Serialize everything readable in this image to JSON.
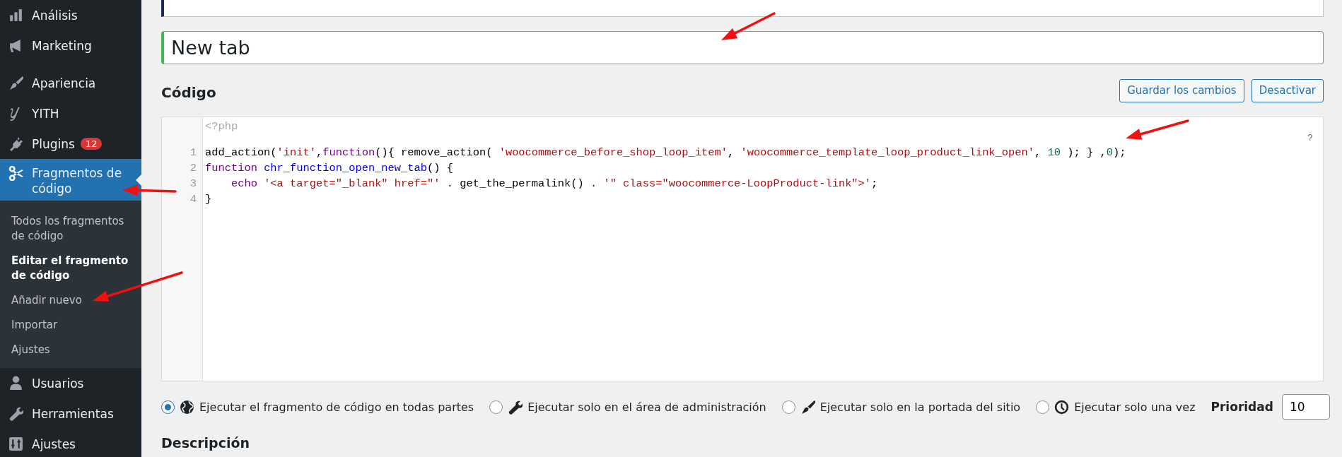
{
  "sidebar": {
    "menu_groups": [
      [
        {
          "label": "Análisis",
          "selected": false
        },
        {
          "label": "Marketing",
          "selected": false
        }
      ],
      [
        {
          "label": "Apariencia",
          "selected": false
        },
        {
          "label": "YITH",
          "selected": false
        },
        {
          "label": "Plugins",
          "selected": false,
          "badge": "12"
        },
        {
          "label": "Fragmentos de código",
          "selected": true,
          "submenu": [
            {
              "label": "Todos los fragmentos de código",
              "selected": false
            },
            {
              "label": "Editar el fragmento de código",
              "selected": true
            },
            {
              "label": "Añadir nuevo",
              "selected": false
            },
            {
              "label": "Importar",
              "selected": false
            },
            {
              "label": "Ajustes",
              "selected": false
            }
          ]
        },
        {
          "label": "Usuarios",
          "selected": false
        },
        {
          "label": "Herramientas",
          "selected": false
        },
        {
          "label": "Ajustes",
          "selected": false
        }
      ]
    ]
  },
  "title_field": {
    "value": "New tab"
  },
  "code_section": {
    "heading": "Código",
    "buttons": [
      "Guardar los cambios",
      "Desactivar"
    ]
  },
  "code_editor": {
    "header": "<?php",
    "help": "?",
    "lines": [
      {
        "number": "1",
        "tokens": [
          {
            "kind": "plain",
            "text": "add_action("
          },
          {
            "kind": "string",
            "text": "'init'"
          },
          {
            "kind": "plain",
            "text": ","
          },
          {
            "kind": "keyword",
            "text": "function"
          },
          {
            "kind": "plain",
            "text": "(){ remove_action( "
          },
          {
            "kind": "string",
            "text": "'woocommerce_before_shop_loop_item'"
          },
          {
            "kind": "plain",
            "text": ", "
          },
          {
            "kind": "string",
            "text": "'woocommerce_template_loop_product_link_open'"
          },
          {
            "kind": "plain",
            "text": ", "
          },
          {
            "kind": "number",
            "text": "10"
          },
          {
            "kind": "plain",
            "text": " ); } ,"
          },
          {
            "kind": "number",
            "text": "0"
          },
          {
            "kind": "plain",
            "text": ");"
          }
        ]
      },
      {
        "number": "2",
        "tokens": [
          {
            "kind": "keyword",
            "text": "function "
          },
          {
            "kind": "def",
            "text": "chr_function_open_new_tab"
          },
          {
            "kind": "plain",
            "text": "() {"
          }
        ]
      },
      {
        "number": "3",
        "tokens": [
          {
            "kind": "keyword",
            "text": "    echo "
          },
          {
            "kind": "string",
            "text": "'<a target=\"_blank\" href=\"'"
          },
          {
            "kind": "plain",
            "text": " . get_the_permalink() . "
          },
          {
            "kind": "string",
            "text": "'\" class=\"woocommerce-LoopProduct-link\">'"
          },
          {
            "kind": "plain",
            "text": ";"
          }
        ]
      },
      {
        "number": "4",
        "tokens": [
          {
            "kind": "plain",
            "text": "}"
          }
        ]
      }
    ]
  },
  "scope_options": [
    {
      "label": "Ejecutar el fragmento de código en todas partes",
      "selected": true
    },
    {
      "label": "Ejecutar solo en el área de administración",
      "selected": false
    },
    {
      "label": "Ejecutar solo en la portada del sitio",
      "selected": false
    },
    {
      "label": "Ejecutar solo una vez",
      "selected": false
    }
  ],
  "priority": {
    "label": "Prioridad",
    "value": "10"
  },
  "description": {
    "heading": "Descripción"
  }
}
